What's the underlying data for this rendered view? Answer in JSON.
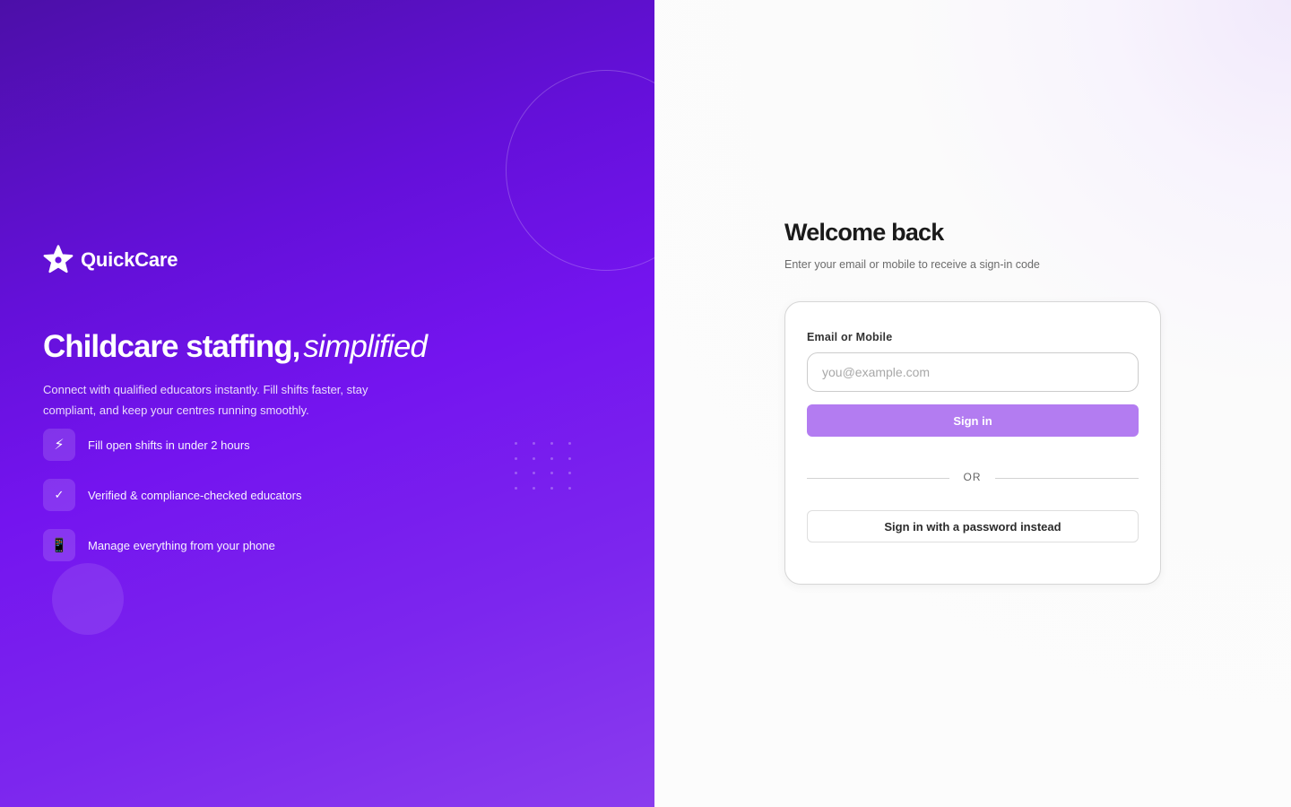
{
  "brand": {
    "name": "QuickCare",
    "logo_icon": "star-logo-icon"
  },
  "hero": {
    "title_main": "Childcare staffing,",
    "title_emphasis": "simplified",
    "description": "Connect with qualified educators instantly. Fill shifts faster, stay compliant, and keep your centres running smoothly.",
    "features": [
      {
        "icon": "lightning-icon",
        "glyph": "⚡",
        "text": "Fill open shifts in under 2 hours"
      },
      {
        "icon": "checkmark-icon",
        "glyph": "✓",
        "text": "Verified & compliance-checked educators"
      },
      {
        "icon": "phone-icon",
        "glyph": "📱",
        "text": "Manage everything from your phone"
      }
    ]
  },
  "auth": {
    "title": "Welcome back",
    "subtitle": "Enter your email or mobile to receive a sign-in code",
    "email_label": "Email or Mobile",
    "email_value": "",
    "email_placeholder": "you@example.com",
    "signin_label": "Sign in",
    "divider_text": "OR",
    "password_label": "Sign in with a password instead"
  },
  "colors": {
    "hero_gradient_start": "#4c0fa8",
    "hero_gradient_end": "#8a3cee",
    "primary_button": "#b37cf1",
    "title_text": "#1a1a1a"
  }
}
